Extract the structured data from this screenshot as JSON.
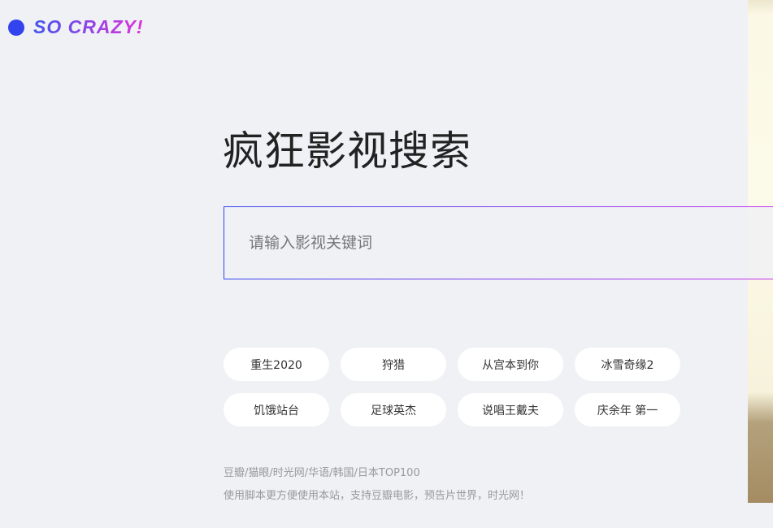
{
  "logo": {
    "text": "SO CRAZY!"
  },
  "title": "疯狂影视搜索",
  "search": {
    "placeholder": "请输入影视关键词",
    "value": ""
  },
  "tags": [
    "重生2020",
    "狩猎",
    "从宫本到你",
    "冰雪奇缘2",
    "饥饿站台",
    "足球英杰",
    "说唱王戴夫",
    "庆余年 第一"
  ],
  "footer": {
    "sources": "豆瓣/猫眼/时光网/华语/韩国/日本TOP100",
    "note": "使用脚本更方便使用本站，支持豆瓣电影，预告片世界，时光网！"
  },
  "colors": {
    "accent_start": "#3344ee",
    "accent_end": "#cc33ee",
    "background": "#f0f1f5"
  }
}
